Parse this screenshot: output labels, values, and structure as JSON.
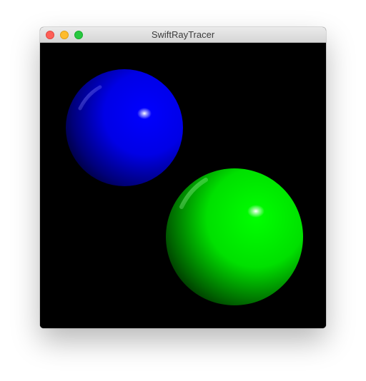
{
  "window": {
    "title": "SwiftRayTracer"
  },
  "scene": {
    "background_color": "#000000",
    "spheres": [
      {
        "name": "blue-sphere",
        "color": "#0000ff"
      },
      {
        "name": "green-sphere",
        "color": "#00ff00"
      }
    ]
  }
}
